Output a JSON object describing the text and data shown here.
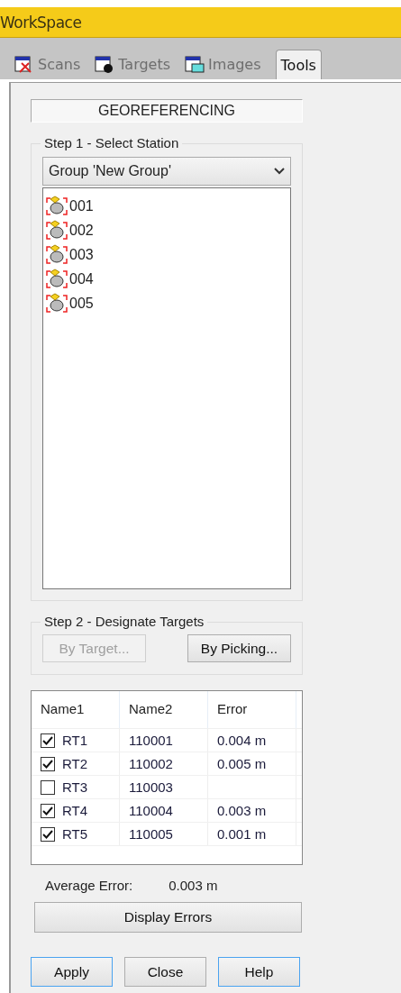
{
  "window": {
    "title": "WorkSpace"
  },
  "tabs": [
    {
      "label": "Scans",
      "selected": false,
      "disabled": true
    },
    {
      "label": "Targets",
      "selected": false,
      "disabled": true
    },
    {
      "label": "Images",
      "selected": false,
      "disabled": true
    },
    {
      "label": "Tools",
      "selected": true,
      "disabled": false
    }
  ],
  "heading": "GEOREFERENCING",
  "step1": {
    "title": "Step 1 - Select Station",
    "dropdown": "Group 'New Group'",
    "stations": [
      "001",
      "002",
      "003",
      "004",
      "005"
    ]
  },
  "step2": {
    "title": "Step 2 - Designate Targets",
    "buttons": [
      {
        "label": "By Target...",
        "disabled": true
      },
      {
        "label": "By Picking...",
        "disabled": false
      }
    ]
  },
  "table": {
    "columns": [
      "Name1",
      "Name2",
      "Error"
    ],
    "rows": [
      {
        "name1": "RT1",
        "name2": "110001",
        "error": "0.004 m",
        "checked": true
      },
      {
        "name1": "RT2",
        "name2": "110002",
        "error": "0.005 m",
        "checked": true
      },
      {
        "name1": "RT3",
        "name2": "110003",
        "checked": false
      },
      {
        "name1": "RT4",
        "name2": "110004",
        "error": "0.003 m",
        "checked": true
      },
      {
        "name1": "RT5",
        "name2": "110005",
        "error": "0.001 m",
        "checked": true
      }
    ]
  },
  "average": {
    "label": "Average Error:",
    "value": "0.003 m"
  },
  "display_button": "Display Errors",
  "buttons": [
    {
      "label": "Apply",
      "focused": true
    },
    {
      "label": "Close",
      "focused": false
    },
    {
      "label": "Help",
      "focused": true
    }
  ]
}
